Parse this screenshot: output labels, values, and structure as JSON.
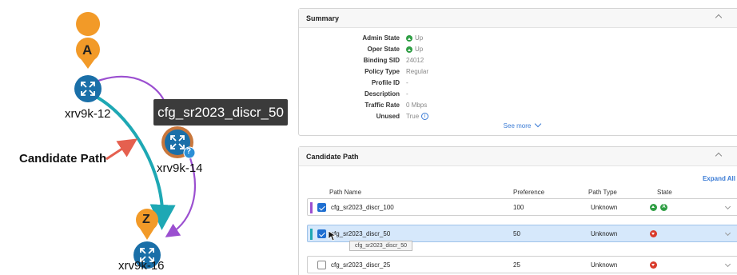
{
  "topology": {
    "nodes": [
      {
        "id": "xrv9k-12",
        "label": "xrv9k-12"
      },
      {
        "id": "xrv9k-14",
        "label": "xrv9k-14"
      },
      {
        "id": "xrv9k-16",
        "label": "xrv9k-16"
      }
    ],
    "marker_a": "A",
    "marker_z": "Z",
    "hover_tooltip": "cfg_sr2023_discr_50",
    "candidate_path_label": "Candidate Path",
    "question_badge": "?",
    "colors": {
      "node": "#1a6fa8",
      "marker": "#f29a28",
      "purple_path": "#9b4fd0",
      "teal_path": "#1ea8b4",
      "arrow": "#e5604f"
    }
  },
  "summary": {
    "title": "Summary",
    "rows": [
      {
        "key": "Admin State",
        "value": "Up",
        "icon": "up-icon"
      },
      {
        "key": "Oper State",
        "value": "Up",
        "icon": "up-icon"
      },
      {
        "key": "Binding SID",
        "value": "24012"
      },
      {
        "key": "Policy Type",
        "value": "Regular"
      },
      {
        "key": "Profile ID",
        "value": "-"
      },
      {
        "key": "Description",
        "value": "-"
      },
      {
        "key": "Traffic Rate",
        "value": "0 Mbps"
      },
      {
        "key": "Unused",
        "value": "True",
        "icon": "info-icon"
      }
    ],
    "see_more": "See more"
  },
  "candidate_path": {
    "title": "Candidate Path",
    "expand_all": "Expand All",
    "columns": {
      "name": "Path Name",
      "preference": "Preference",
      "type": "Path Type",
      "state": "State"
    },
    "rows": [
      {
        "name": "cfg_sr2023_discr_100",
        "preference": "100",
        "type": "Unknown",
        "checked": true,
        "selected": false,
        "bar": "#9b4fd0",
        "states": [
          "up",
          "admin"
        ]
      },
      {
        "name": "cfg_sr2023_discr_50",
        "preference": "50",
        "type": "Unknown",
        "checked": true,
        "selected": true,
        "bar": "#1ea8b4",
        "states": [
          "down"
        ]
      },
      {
        "name": "cfg_sr2023_discr_25",
        "preference": "25",
        "type": "Unknown",
        "checked": false,
        "selected": false,
        "bar": "",
        "states": [
          "down"
        ]
      }
    ],
    "row_tooltip": "cfg_sr2023_discr_50",
    "admin_letter": "A"
  }
}
